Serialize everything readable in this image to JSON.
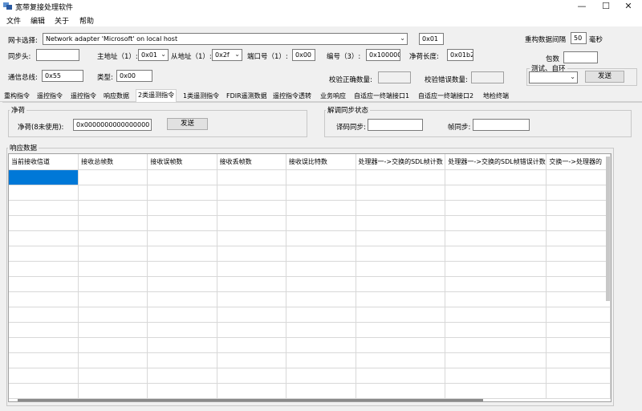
{
  "window": {
    "title": "宽带复接处理软件",
    "controls": [
      "—",
      "☐",
      "✕"
    ]
  },
  "menu": [
    "文件",
    "编辑",
    "关于",
    "帮助"
  ],
  "config": {
    "nic_label": "网卡选择:",
    "nic_value": "Network adapter 'Microsoft' on local host",
    "nic_hex": "0x01",
    "rebuild_interval_label": "重构数据间隔",
    "rebuild_interval_value": "50",
    "rebuild_interval_unit": "毫秒",
    "sync_head_label": "同步头:",
    "sync_head_value": "",
    "master_addr_label": "主地址（1）:",
    "master_addr_value": "0x01",
    "slave_addr_label": "从地址（1）:",
    "slave_addr_value": "0x2f",
    "port_label": "端口号（1）:",
    "port_value": "0x00",
    "code_label": "编号（3）:",
    "code_value": "0x100000",
    "payload_len_label": "净荷长度:",
    "payload_len_value": "0x01b2",
    "packet_count_label": "包数",
    "packet_count_value": "",
    "bus_label": "通信总线:",
    "bus_value": "0x55",
    "type_label": "类型:",
    "type_value": "0x00",
    "check_ok_label": "校验正确数量:",
    "check_ok_value": "",
    "check_err_label": "校验错误数量:",
    "check_err_value": "",
    "test_group_label": "测试、自环",
    "test_select_value": "",
    "send_label": "发送"
  },
  "tabs": [
    {
      "label": "重构指令",
      "active": false
    },
    {
      "label": "遥控指令",
      "active": false
    },
    {
      "label": "遥控指令",
      "active": false
    },
    {
      "label": "响应数据",
      "active": false
    },
    {
      "label": "2类遥测指令",
      "active": true
    },
    {
      "label": "1类遥测指令",
      "active": false
    },
    {
      "label": "FDIR遥测数据",
      "active": false
    },
    {
      "label": "遥控指令透转",
      "active": false
    },
    {
      "label": "业务响应",
      "active": false
    },
    {
      "label": "自适应一终端接口1",
      "active": false
    },
    {
      "label": "自适应一终端接口2",
      "active": false
    },
    {
      "label": "地检终端",
      "active": false
    }
  ],
  "payload_group": {
    "title": "净荷",
    "label": "净荷(8未使用):",
    "value": "0x0000000000000000",
    "send_label": "发送"
  },
  "demod_group": {
    "title": "解调同步状态",
    "decode_sync_label": "译码同步:",
    "decode_sync_value": "",
    "frame_sync_label": "帧同步:",
    "frame_sync_value": ""
  },
  "response": {
    "title": "响应数据",
    "columns": [
      "当前接收信道",
      "接收总帧数",
      "接收误帧数",
      "接收丢帧数",
      "接收误比特数",
      "处理器一->交换的SDL帧计数",
      "处理器一->交换的SDL帧错误计数",
      "交换一->处理器的"
    ],
    "row_count": 15
  }
}
